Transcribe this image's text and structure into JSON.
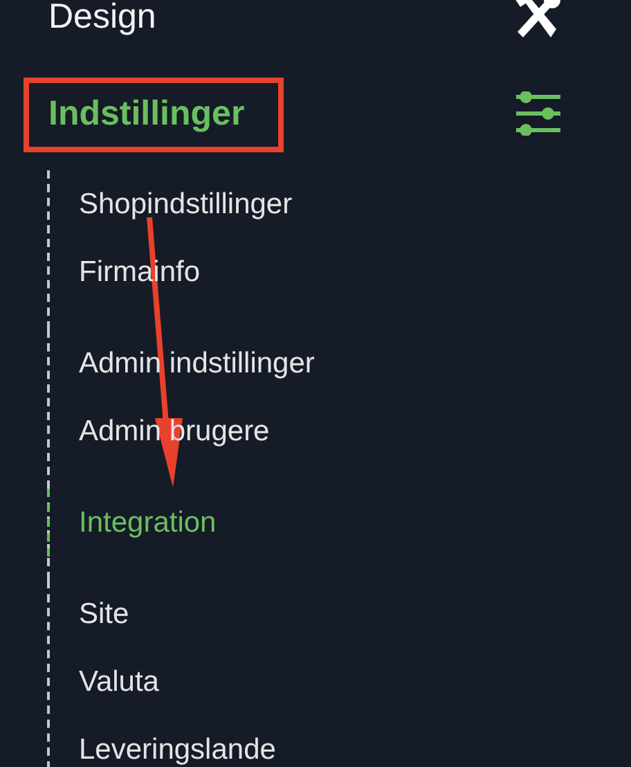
{
  "menu": [
    {
      "label": "Design",
      "kind": "tools",
      "selected": false
    },
    {
      "label": "Indstillinger",
      "kind": "sliders",
      "selected": true,
      "groups": [
        [
          {
            "label": "Shopindstillinger",
            "selected": false
          },
          {
            "label": "Firmainfo",
            "selected": false
          }
        ],
        [
          {
            "label": "Admin indstillinger",
            "selected": false
          },
          {
            "label": "Admin brugere",
            "selected": false
          }
        ],
        [
          {
            "label": "Integration",
            "selected": true
          }
        ],
        [
          {
            "label": "Site",
            "selected": false
          },
          {
            "label": "Valuta",
            "selected": false
          },
          {
            "label": "Leveringslande",
            "selected": false
          }
        ]
      ]
    }
  ]
}
